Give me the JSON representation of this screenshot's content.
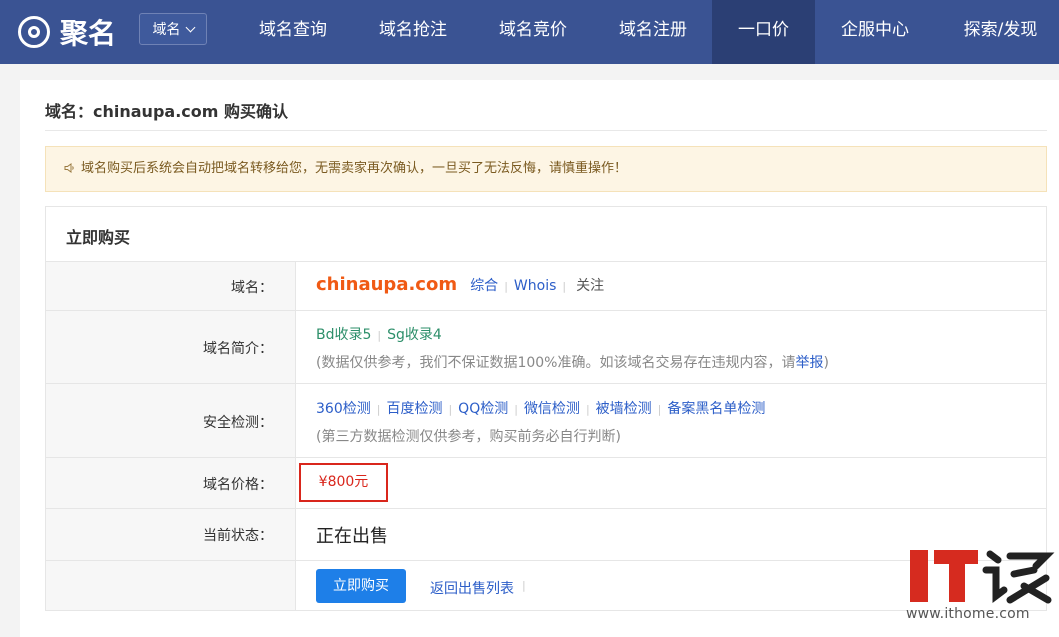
{
  "nav": {
    "logo": "聚名",
    "select_label": "域名",
    "items": [
      "域名查询",
      "域名抢注",
      "域名竞价",
      "域名注册",
      "一口价",
      "企服中心",
      "探索/发现"
    ],
    "active": "一口价"
  },
  "page": {
    "title": "域名：chinaupa.com 购买确认",
    "notice": "域名购买后系统会自动把域名转移给您，无需卖家再次确认，一旦买了无法反悔，请慎重操作！"
  },
  "box": {
    "title": "立即购买",
    "domain_label": "域名：",
    "domain": "chinaupa.com",
    "domain_links": [
      "综合",
      "Whois",
      "关注"
    ],
    "intro_label": "域名简介：",
    "intro_stats": [
      "Bd收录5",
      "Sg收录4"
    ],
    "intro_note": "(数据仅供参考，我们不保证数据100%准确。如该域名交易存在违规内容，请",
    "intro_report": "举报",
    "intro_close": ")",
    "security_label": "安全检测：",
    "security_links": [
      "360检测",
      "百度检测",
      "QQ检测",
      "微信检测",
      "被墙检测",
      "备案黑名单检测"
    ],
    "security_note": "(第三方数据检测仅供参考，购买前务必自行判断)",
    "price_label": "域名价格：",
    "price": "¥800元",
    "status_label": "当前状态：",
    "status": "正在出售",
    "buy_button": "立即购买",
    "back_link": "返回出售列表"
  },
  "watermark": {
    "text": "IT之家",
    "url": "www.ithome.com"
  },
  "colors": {
    "nav_bg": "#3a5393",
    "accent": "#1e7fe8",
    "domain": "#f05a14",
    "price": "#d9261c",
    "watermark": "#d62b1f"
  }
}
